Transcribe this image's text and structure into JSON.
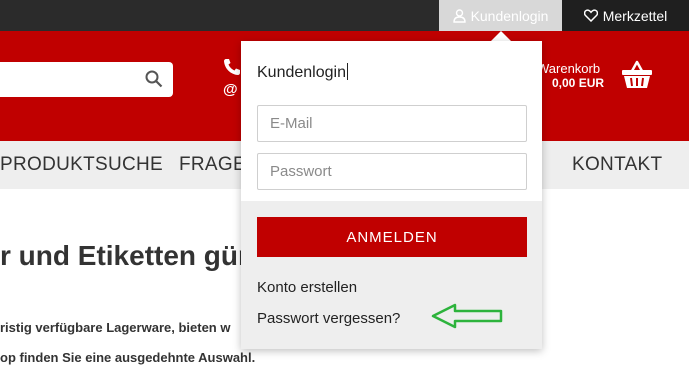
{
  "topbar": {
    "login_label": "Kundenlogin",
    "wishlist_label": "Merkzettel"
  },
  "header": {
    "cart_label": "Warenkorb",
    "cart_price": "0,00 EUR",
    "at_symbol": "@"
  },
  "nav": {
    "items": [
      "PRODUKTSUCHE",
      "FRAGE",
      "KONTAKT"
    ]
  },
  "content": {
    "headline": "r und Etiketten gün",
    "line1": "ristig verfügbare Lagerware, bieten w",
    "line2": "op finden Sie eine ausgedehnte Auswahl."
  },
  "dropdown": {
    "title": "Kundenlogin",
    "email_placeholder": "E-Mail",
    "password_placeholder": "Passwort",
    "login_button": "ANMELDEN",
    "create_account": "Konto erstellen",
    "forgot_password": "Passwort vergessen?"
  },
  "colors": {
    "brand_red": "#c00000",
    "annotation_arrow": "#2db33c"
  }
}
